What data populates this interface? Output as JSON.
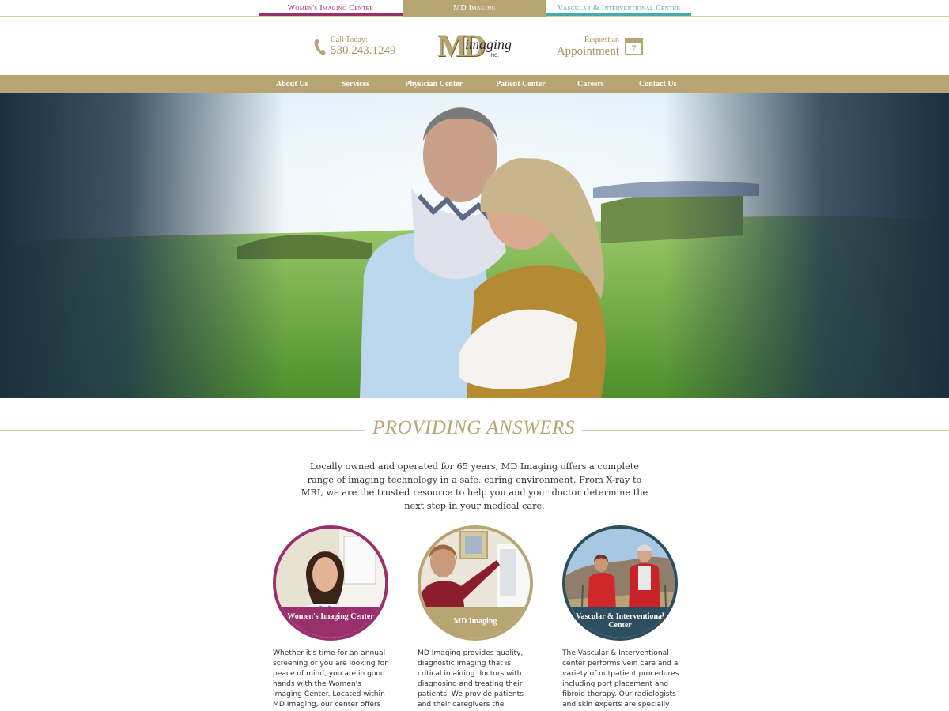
{
  "top_tabs": {
    "women": "Women's Imaging Center",
    "md": "MD Imaging",
    "vascular": "Vascular & Interventional Center"
  },
  "header": {
    "phone_label": "Call Today:",
    "phone_number": "530.243.1249",
    "logo_md": "MD",
    "logo_imaging": "imaging",
    "logo_inc": "INC.",
    "appointment_label": "Request an",
    "appointment_text": "Appointment",
    "calendar_day": "7"
  },
  "nav": {
    "items": [
      "About Us",
      "Services",
      "Physician Center",
      "Patient Center",
      "Careers",
      "Contact Us"
    ]
  },
  "section": {
    "heading": "PROVIDING ANSWERS",
    "intro": "Locally owned and operated for 65 years, MD Imaging offers a complete range of imaging technology in a safe, caring environment. From X-ray to MRI, we are the trusted resource to help you and your doctor determine the next step in your medical care."
  },
  "cards": [
    {
      "label": "Women's Imaging Center",
      "text": "Whether it's time for an annual screening or you are looking for peace of mind, you are in good hands with the Women's Imaging Center. Located within MD Imaging, our center offers advanced mam-"
    },
    {
      "label": "MD Imaging",
      "text": "MD Imaging provides quality, diagnostic imaging that is critical in aiding doctors with diagnosing and treating their patients. We provide patients and their caregivers the information needed to make impor-"
    },
    {
      "label": "Vascular & Interventional Center",
      "text": "The Vascular & Interventional center performs vein care and a variety of outpatient procedures including port placement and fibroid therapy. Our radiologists and skin experts are specially trained to perform"
    }
  ],
  "colors": {
    "gold": "#b8a574",
    "women": "#9a2f6e",
    "vascular": "#2d4e5e",
    "vascular_tab": "#4aa9ad"
  },
  "icons": {
    "phone": "phone-icon",
    "calendar": "calendar-icon"
  }
}
